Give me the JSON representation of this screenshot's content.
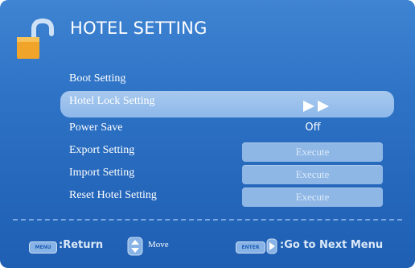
{
  "header": {
    "title": "HOTEL SETTING",
    "icon": "open-padlock-icon"
  },
  "menu": {
    "items": [
      {
        "label": "Boot Setting"
      },
      {
        "label": "Hotel Lock Setting",
        "selected": true,
        "indicator_icon": "double-play-arrow-icon"
      },
      {
        "label": "Power Save",
        "value": "Off"
      },
      {
        "label": "Export Setting",
        "action": "Execute"
      },
      {
        "label": "Import Setting",
        "action": "Execute"
      },
      {
        "label": "Reset Hotel Setting",
        "action": "Execute"
      }
    ]
  },
  "footer": {
    "menu_key": "MENU",
    "return_label": ":Return",
    "move_icon": "up-down-arrow-icon",
    "move_label": "Move",
    "enter_key": "ENTER",
    "next_icon": "right-arrow-icon",
    "next_label": ":Go to Next Menu"
  },
  "colors": {
    "background": "#2e73c6",
    "highlight": "#a8c9ee",
    "button": "#8fb7e6",
    "text": "#ffffff"
  }
}
